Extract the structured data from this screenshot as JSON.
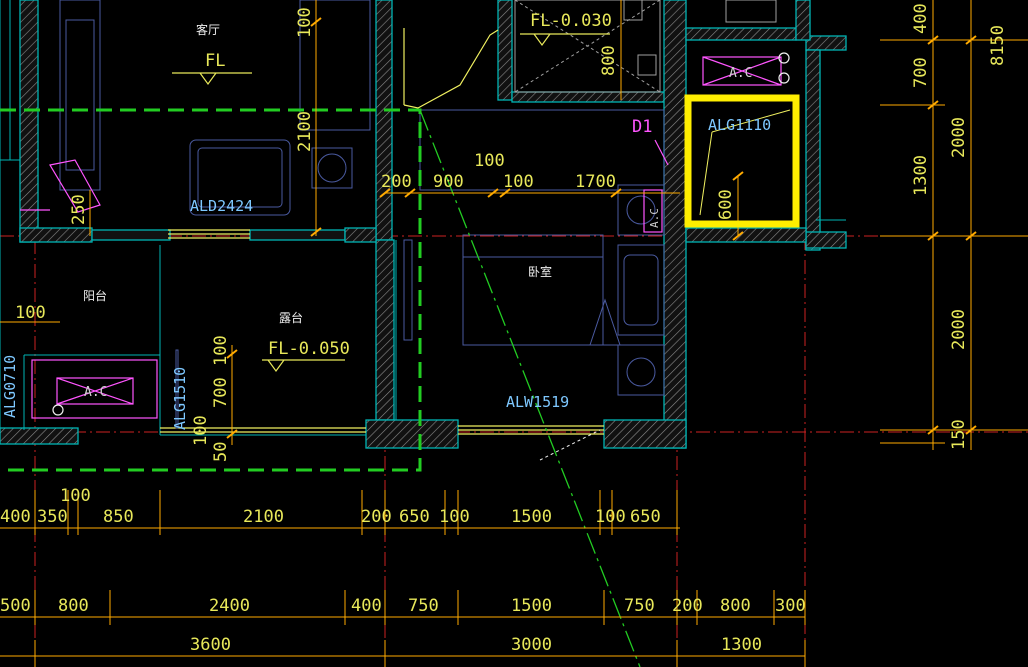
{
  "rooms": {
    "living": "客厅",
    "balcony": "阳台",
    "terrace": "露台",
    "bedroom": "卧室"
  },
  "levels": {
    "living": "FL",
    "bath": "FL-0.030",
    "terrace": "FL-0.050"
  },
  "openings": {
    "ald2424": "ALD2424",
    "alg1110": "ALG1110",
    "alw1519": "ALW1519",
    "alg1510": "ALG1510",
    "alg0710": "ALG0710",
    "d1": "D1"
  },
  "ac_labels": {
    "top": "A.C",
    "left": "A.C",
    "small": "A.C"
  },
  "interior_dims": {
    "d100_top": "100",
    "d800": "800",
    "d2100_v": "2100",
    "d200": "200",
    "d900": "900",
    "d100_a": "100",
    "d100_b": "100",
    "d1700": "1700",
    "d600": "600",
    "d250": "250",
    "d100_left": "100",
    "d100_terrace": "100",
    "d700_terrace": "700",
    "d100_bottom": "100",
    "d50": "50"
  },
  "right_dims": [
    "400",
    "700",
    "1300",
    "2000",
    "8150",
    "2000",
    "150"
  ],
  "dim_row_1": {
    "extra": "100",
    "values": [
      "400",
      "350",
      "850",
      "2100",
      "200",
      "650",
      "100",
      "1500",
      "100",
      "650"
    ]
  },
  "dim_row_2": [
    "500",
    "800",
    "2400",
    "400",
    "750",
    "1500",
    "750",
    "200",
    "800",
    "300"
  ],
  "dim_row_3": [
    "3600",
    "3000",
    "1300"
  ],
  "colors": {
    "background": "#000000",
    "dimension": "#ffaa00",
    "dim_text": "#e8e85a",
    "wall": "#00b4b4",
    "wall_hatch": "#8a8a8a",
    "area_boundary": "#22cc22",
    "highlight": "#ffee00",
    "annotation": "#ff55ff",
    "gridline": "#cc2222",
    "furniture": "#4a5aa0"
  }
}
